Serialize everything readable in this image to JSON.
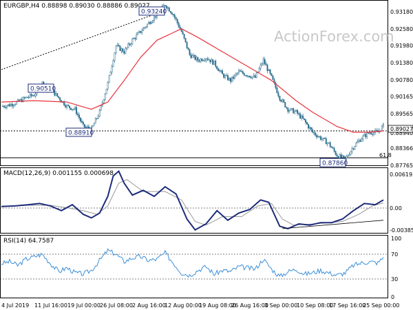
{
  "colors": {
    "background": "#ffffff",
    "frame": "#000000",
    "candle": "#2d6e8e",
    "ma_line": "#e8323c",
    "macd_line": "#1c2b7a",
    "signal_line": "#9a9a9a",
    "rsi_line": "#3a8ed8",
    "watermark": "#c8c8c8",
    "label_box": "#1c2b7a"
  },
  "watermark": "ActionForex.com",
  "chart_data": [
    {
      "type": "candlestick",
      "panel": "price",
      "header": "EURGBP,H4  0.88898 0.89030 0.88886 0.89027",
      "ylim": [
        0.8765,
        0.9335
      ],
      "y_ticks": [
        "0.93180",
        "0.92580",
        "0.91980",
        "0.91380",
        "0.90780",
        "0.90165",
        "0.89565",
        "0.88940",
        "0.88366",
        "0.87765"
      ],
      "last_price_label": "0.89027",
      "current_level_label": "0.88940",
      "fib_label": "61.8",
      "annotations": [
        "0.93240",
        "0.90510",
        "0.88910",
        "0.87860"
      ],
      "x_ticks": [
        "4 Jul 2019",
        "11 Jul 16:00",
        "19 Jul 00:00",
        "26 Jul 08:00",
        "2 Aug 16:00",
        "12 Aug 00:00",
        "19 Aug 08:00",
        "26 Aug 16:00",
        "3 Sep 00:00",
        "10 Sep 08:00",
        "17 Sep 16:00",
        "25 Sep 00:00"
      ],
      "price_path": [
        [
          0,
          0.897
        ],
        [
          6,
          0.8975
        ],
        [
          12,
          0.8985
        ],
        [
          18,
          0.9
        ],
        [
          24,
          0.901
        ],
        [
          30,
          0.9051
        ],
        [
          36,
          0.903
        ],
        [
          42,
          0.9
        ],
        [
          48,
          0.897
        ],
        [
          54,
          0.896
        ],
        [
          60,
          0.89
        ],
        [
          66,
          0.8891
        ],
        [
          72,
          0.895
        ],
        [
          78,
          0.905
        ],
        [
          84,
          0.918
        ],
        [
          90,
          0.916
        ],
        [
          96,
          0.92
        ],
        [
          102,
          0.923
        ],
        [
          108,
          0.926
        ],
        [
          114,
          0.929
        ],
        [
          120,
          0.9324
        ],
        [
          126,
          0.929
        ],
        [
          132,
          0.923
        ],
        [
          138,
          0.915
        ],
        [
          144,
          0.913
        ],
        [
          150,
          0.914
        ],
        [
          156,
          0.912
        ],
        [
          162,
          0.908
        ],
        [
          168,
          0.906
        ],
        [
          174,
          0.909
        ],
        [
          180,
          0.908
        ],
        [
          186,
          0.907
        ],
        [
          192,
          0.913
        ],
        [
          198,
          0.907
        ],
        [
          204,
          0.9
        ],
        [
          210,
          0.896
        ],
        [
          216,
          0.895
        ],
        [
          222,
          0.892
        ],
        [
          228,
          0.888
        ],
        [
          234,
          0.886
        ],
        [
          240,
          0.884
        ],
        [
          246,
          0.88
        ],
        [
          252,
          0.8786
        ],
        [
          258,
          0.883
        ],
        [
          264,
          0.886
        ],
        [
          270,
          0.888
        ],
        [
          276,
          0.888
        ],
        [
          280,
          0.8903
        ]
      ],
      "ma_path": [
        [
          0,
          0.8985
        ],
        [
          24,
          0.899
        ],
        [
          48,
          0.8985
        ],
        [
          66,
          0.896
        ],
        [
          78,
          0.8985
        ],
        [
          90,
          0.906
        ],
        [
          102,
          0.914
        ],
        [
          114,
          0.92
        ],
        [
          132,
          0.924
        ],
        [
          144,
          0.921
        ],
        [
          162,
          0.916
        ],
        [
          180,
          0.911
        ],
        [
          198,
          0.906
        ],
        [
          216,
          0.899
        ],
        [
          228,
          0.895
        ],
        [
          246,
          0.89
        ],
        [
          258,
          0.888
        ],
        [
          270,
          0.888
        ],
        [
          280,
          0.8885
        ]
      ]
    },
    {
      "type": "line",
      "panel": "macd",
      "header": "MACD(12,26,9) 0.001155 0.000698",
      "ylim": [
        -0.0043,
        0.0064
      ],
      "y_ticks": [
        "0.006195",
        "0.00",
        "-0.003851"
      ],
      "series": [
        {
          "name": "MACD",
          "points": [
            [
              0,
              0.0001
            ],
            [
              10,
              0.0002
            ],
            [
              20,
              0.0004
            ],
            [
              28,
              0.0006
            ],
            [
              36,
              0.0002
            ],
            [
              44,
              -0.0006
            ],
            [
              52,
              0.0004
            ],
            [
              60,
              -0.0012
            ],
            [
              66,
              -0.0018
            ],
            [
              72,
              -0.001
            ],
            [
              78,
              0.0018
            ],
            [
              82,
              0.0052
            ],
            [
              86,
              0.006
            ],
            [
              90,
              0.004
            ],
            [
              96,
              0.002
            ],
            [
              104,
              0.0028
            ],
            [
              112,
              0.0018
            ],
            [
              120,
              0.0034
            ],
            [
              128,
              0.0022
            ],
            [
              136,
              -0.002
            ],
            [
              142,
              -0.0038
            ],
            [
              150,
              -0.0028
            ],
            [
              158,
              -0.0006
            ],
            [
              166,
              -0.0022
            ],
            [
              174,
              -0.001
            ],
            [
              182,
              -0.0004
            ],
            [
              190,
              0.0012
            ],
            [
              196,
              0.0008
            ],
            [
              204,
              -0.0032
            ],
            [
              210,
              -0.0036
            ],
            [
              218,
              -0.0028
            ],
            [
              226,
              -0.003
            ],
            [
              234,
              -0.0026
            ],
            [
              242,
              -0.0026
            ],
            [
              250,
              -0.002
            ],
            [
              258,
              -0.0006
            ],
            [
              266,
              0.0006
            ],
            [
              274,
              0.0004
            ],
            [
              280,
              0.0012
            ]
          ]
        },
        {
          "name": "Signal",
          "points": [
            [
              0,
              0.0001
            ],
            [
              20,
              0.0003
            ],
            [
              36,
              0.0003
            ],
            [
              48,
              -0.0001
            ],
            [
              60,
              -0.0006
            ],
            [
              70,
              -0.0012
            ],
            [
              78,
              0.0002
            ],
            [
              86,
              0.004
            ],
            [
              92,
              0.0046
            ],
            [
              104,
              0.0026
            ],
            [
              120,
              0.0026
            ],
            [
              132,
              0.0012
            ],
            [
              142,
              -0.0024
            ],
            [
              150,
              -0.003
            ],
            [
              162,
              -0.0016
            ],
            [
              176,
              -0.0016
            ],
            [
              188,
              0.0002
            ],
            [
              198,
              0.0006
            ],
            [
              206,
              -0.002
            ],
            [
              214,
              -0.003
            ],
            [
              230,
              -0.0028
            ],
            [
              250,
              -0.0024
            ],
            [
              262,
              -0.0012
            ],
            [
              272,
              0.0002
            ],
            [
              280,
              0.0007
            ]
          ]
        }
      ],
      "trendline": [
        [
          206,
          -0.0036
        ],
        [
          280,
          -0.0022
        ]
      ]
    },
    {
      "type": "line",
      "panel": "rsi",
      "header": "RSI(14) 64.7587",
      "ylim": [
        0,
        100
      ],
      "y_ticks": [
        "100",
        "70",
        "30",
        "0"
      ],
      "series": [
        {
          "name": "RSI(14)",
          "points": [
            [
              0,
              55
            ],
            [
              6,
              58
            ],
            [
              12,
              52
            ],
            [
              18,
              62
            ],
            [
              24,
              66
            ],
            [
              30,
              70
            ],
            [
              36,
              55
            ],
            [
              42,
              42
            ],
            [
              48,
              48
            ],
            [
              54,
              40
            ],
            [
              60,
              38
            ],
            [
              66,
              44
            ],
            [
              72,
              60
            ],
            [
              78,
              76
            ],
            [
              84,
              70
            ],
            [
              90,
              58
            ],
            [
              96,
              64
            ],
            [
              102,
              66
            ],
            [
              108,
              60
            ],
            [
              114,
              62
            ],
            [
              120,
              72
            ],
            [
              126,
              56
            ],
            [
              132,
              40
            ],
            [
              138,
              36
            ],
            [
              144,
              44
            ],
            [
              150,
              50
            ],
            [
              156,
              38
            ],
            [
              162,
              44
            ],
            [
              168,
              42
            ],
            [
              174,
              50
            ],
            [
              180,
              48
            ],
            [
              186,
              46
            ],
            [
              192,
              62
            ],
            [
              198,
              46
            ],
            [
              204,
              34
            ],
            [
              210,
              42
            ],
            [
              216,
              46
            ],
            [
              222,
              38
            ],
            [
              228,
              40
            ],
            [
              234,
              44
            ],
            [
              240,
              40
            ],
            [
              246,
              36
            ],
            [
              252,
              40
            ],
            [
              258,
              52
            ],
            [
              264,
              56
            ],
            [
              270,
              58
            ],
            [
              276,
              56
            ],
            [
              280,
              65
            ]
          ]
        }
      ]
    }
  ]
}
